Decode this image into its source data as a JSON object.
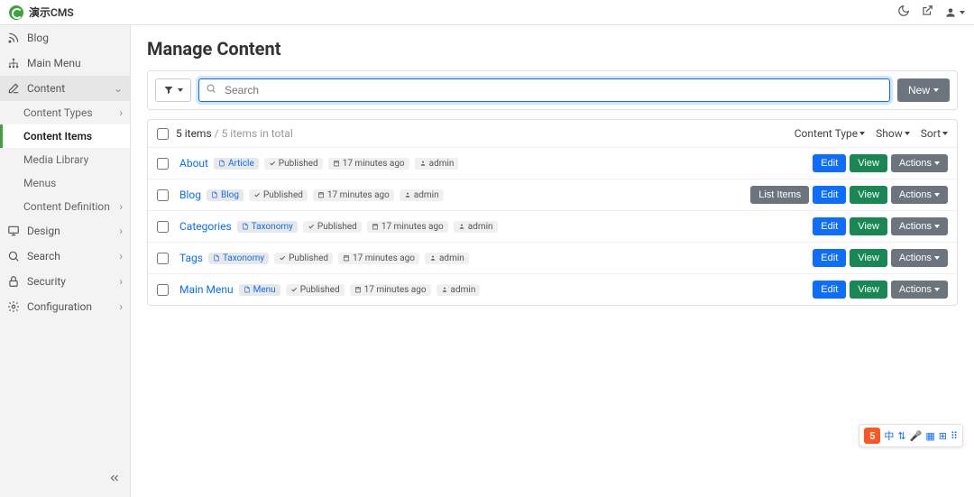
{
  "brand": "演示CMS",
  "page_title": "Manage Content",
  "search": {
    "placeholder": "Search"
  },
  "new_button": "New",
  "sidebar": [
    {
      "icon": "rss",
      "label": "Blog"
    },
    {
      "icon": "sitemap",
      "label": "Main Menu"
    },
    {
      "icon": "edit",
      "label": "Content",
      "active": true,
      "expanded": true,
      "children": [
        {
          "label": "Content Types",
          "has_chev": true
        },
        {
          "label": "Content Items",
          "active": true
        },
        {
          "label": "Media Library"
        },
        {
          "label": "Menus"
        },
        {
          "label": "Content Definition",
          "has_chev": true
        }
      ]
    },
    {
      "icon": "monitor",
      "label": "Design",
      "has_chev": true
    },
    {
      "icon": "search",
      "label": "Search",
      "has_chev": true
    },
    {
      "icon": "lock",
      "label": "Security",
      "has_chev": true
    },
    {
      "icon": "gear",
      "label": "Configuration",
      "has_chev": true
    }
  ],
  "list": {
    "count_label": "5 items",
    "total_label": "/ 5 items in total",
    "header_buttons": [
      "Content Type",
      "Show",
      "Sort"
    ],
    "rows": [
      {
        "title": "About",
        "type": "Article",
        "status": "Published",
        "time": "17 minutes ago",
        "user": "admin",
        "actions": [
          "Edit",
          "View",
          "Actions"
        ],
        "action_styles": [
          "primary",
          "success",
          "secondary"
        ]
      },
      {
        "title": "Blog",
        "type": "Blog",
        "status": "Published",
        "time": "17 minutes ago",
        "user": "admin",
        "actions": [
          "List Items",
          "Edit",
          "View",
          "Actions"
        ],
        "action_styles": [
          "secondary",
          "primary",
          "success",
          "secondary"
        ]
      },
      {
        "title": "Categories",
        "type": "Taxonomy",
        "status": "Published",
        "time": "17 minutes ago",
        "user": "admin",
        "actions": [
          "Edit",
          "View",
          "Actions"
        ],
        "action_styles": [
          "primary",
          "success",
          "secondary"
        ]
      },
      {
        "title": "Tags",
        "type": "Taxonomy",
        "status": "Published",
        "time": "17 minutes ago",
        "user": "admin",
        "actions": [
          "Edit",
          "View",
          "Actions"
        ],
        "action_styles": [
          "primary",
          "success",
          "secondary"
        ]
      },
      {
        "title": "Main Menu",
        "type": "Menu",
        "status": "Published",
        "time": "17 minutes ago",
        "user": "admin",
        "actions": [
          "Edit",
          "View",
          "Actions"
        ],
        "action_styles": [
          "primary",
          "success",
          "secondary"
        ]
      }
    ]
  },
  "float_widget": {
    "badge": "5",
    "items": [
      "中",
      "⇅",
      "🎤",
      "⊞",
      "⊞",
      "⊞"
    ]
  }
}
